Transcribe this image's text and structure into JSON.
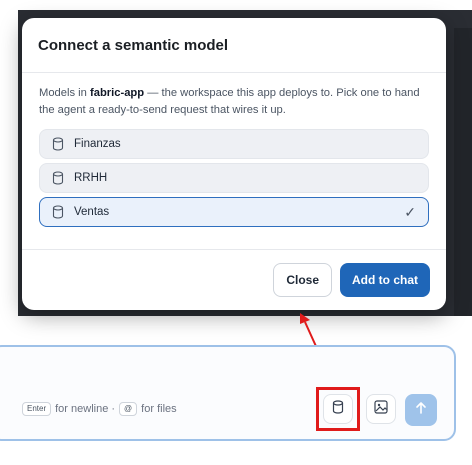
{
  "modal": {
    "title": "Connect a semantic model",
    "description_prefix": "Models in ",
    "workspace": "fabric-app",
    "description_suffix": " — the workspace this app deploys to. Pick one to hand the agent a ready-to-send request that wires it up.",
    "models": [
      {
        "label": "Finanzas",
        "selected": false
      },
      {
        "label": "RRHH",
        "selected": false
      },
      {
        "label": "Ventas",
        "selected": true
      }
    ],
    "selected_check": "✓",
    "close_label": "Close",
    "add_label": "Add to chat"
  },
  "composer": {
    "enter_key": "Enter",
    "newline_text": "for newline ·",
    "at_key": "@",
    "files_text": "for files",
    "send_icon": "arrow-up-icon",
    "model_icon": "database-icon",
    "image_icon": "image-icon"
  },
  "colors": {
    "primary": "#1f66b8",
    "selected_border": "#2f6fbf",
    "annotation": "#e01b1b",
    "send_disabled": "#9fc3ea"
  }
}
